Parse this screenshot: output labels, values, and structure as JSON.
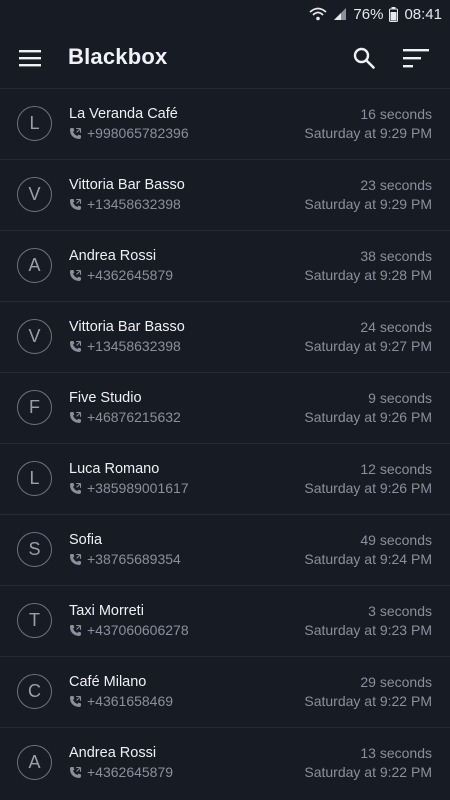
{
  "status_bar": {
    "battery": "76%",
    "time": "08:41"
  },
  "app_bar": {
    "title": "Blackbox"
  },
  "colors": {
    "background": "#171b24",
    "divider": "#252a35",
    "text_primary": "#eef0f3",
    "text_secondary": "#8a909b"
  },
  "calls": [
    {
      "initial": "L",
      "name": "La Veranda Café",
      "number": "+998065782396",
      "duration": "16 seconds",
      "datetime": "Saturday at 9:29 PM"
    },
    {
      "initial": "V",
      "name": "Vittoria Bar Basso",
      "number": "+13458632398",
      "duration": "23 seconds",
      "datetime": "Saturday at 9:29 PM"
    },
    {
      "initial": "A",
      "name": "Andrea Rossi",
      "number": "+4362645879",
      "duration": "38 seconds",
      "datetime": "Saturday at 9:28 PM"
    },
    {
      "initial": "V",
      "name": "Vittoria Bar Basso",
      "number": "+13458632398",
      "duration": "24 seconds",
      "datetime": "Saturday at 9:27 PM"
    },
    {
      "initial": "F",
      "name": "Five Studio",
      "number": "+46876215632",
      "duration": "9 seconds",
      "datetime": "Saturday at 9:26 PM"
    },
    {
      "initial": "L",
      "name": "Luca Romano",
      "number": "+385989001617",
      "duration": "12 seconds",
      "datetime": "Saturday at 9:26 PM"
    },
    {
      "initial": "S",
      "name": "Sofia",
      "number": "+38765689354",
      "duration": "49 seconds",
      "datetime": "Saturday at 9:24 PM"
    },
    {
      "initial": "T",
      "name": "Taxi Morreti",
      "number": "+437060606278",
      "duration": "3 seconds",
      "datetime": "Saturday at 9:23 PM"
    },
    {
      "initial": "C",
      "name": "Café Milano",
      "number": "+4361658469",
      "duration": "29 seconds",
      "datetime": "Saturday at 9:22 PM"
    },
    {
      "initial": "A",
      "name": "Andrea Rossi",
      "number": "+4362645879",
      "duration": "13 seconds",
      "datetime": "Saturday at 9:22 PM"
    }
  ]
}
